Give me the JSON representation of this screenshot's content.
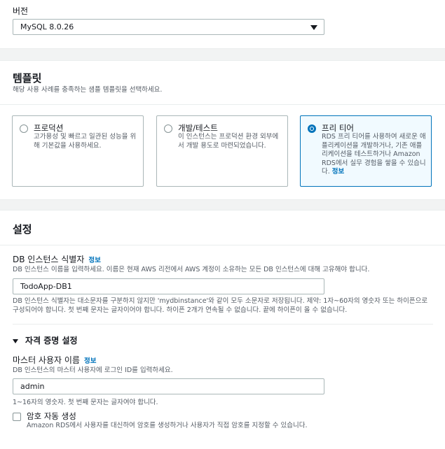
{
  "version": {
    "label": "버전",
    "selected": "MySQL 8.0.26"
  },
  "templates": {
    "heading": "템플릿",
    "description": "해당 사용 사례를 충족하는 샘플 템플릿을 선택하세요.",
    "options": [
      {
        "title": "프로덕션",
        "description": "고가용성 및 빠르고 일관된 성능을 위해 기본값을 사용하세요.",
        "selected": false
      },
      {
        "title": "개발/테스트",
        "description": "이 인스턴스는 프로덕션 환경 외부에서 개발 용도로 마련되었습니다.",
        "selected": false
      },
      {
        "title": "프리 티어",
        "description": "RDS 프리 티어를 사용하여 새로운 애플리케이션을 개발하거나, 기존 애플리케이션을 테스트하거나 Amazon RDS에서 실무 경험을 쌓을 수 있습니다.",
        "info": "정보",
        "selected": true
      }
    ]
  },
  "settings": {
    "heading": "설정",
    "db_identifier": {
      "label": "DB 인스턴스 식별자",
      "info": "정보",
      "description": "DB 인스턴스 이름을 입력하세요. 이름은 현재 AWS 리전에서 AWS 계정이 소유하는 모든 DB 인스턴스에 대해 고유해야 합니다.",
      "value": "TodoApp-DB1",
      "constraint": "DB 인스턴스 식별자는 대소문자를 구분하지 않지만 'mydbinstance'와 같이 모두 소문자로 저장됩니다. 제약: 1자~60자의 영숫자 또는 하이픈으로 구성되어야 합니다. 첫 번째 문자는 글자이어야 합니다. 하이픈 2개가 연속될 수 없습니다. 끝에 하이픈이 올 수 없습니다."
    },
    "credentials": {
      "toggle_label": "자격 증명 설정",
      "master_username": {
        "label": "마스터 사용자 이름",
        "info": "정보",
        "description": "DB 인스턴스의 마스터 사용자에 로그인 ID를 입력하세요.",
        "value": "admin",
        "constraint": "1~16자의 영숫자. 첫 번째 문자는 글자여야 합니다."
      },
      "auto_password": {
        "label": "암호 자동 생성",
        "description": "Amazon RDS에서 사용자를 대신하여 암호를 생성하거나 사용자가 직접 암호를 지정할 수 있습니다.",
        "checked": false
      }
    }
  }
}
